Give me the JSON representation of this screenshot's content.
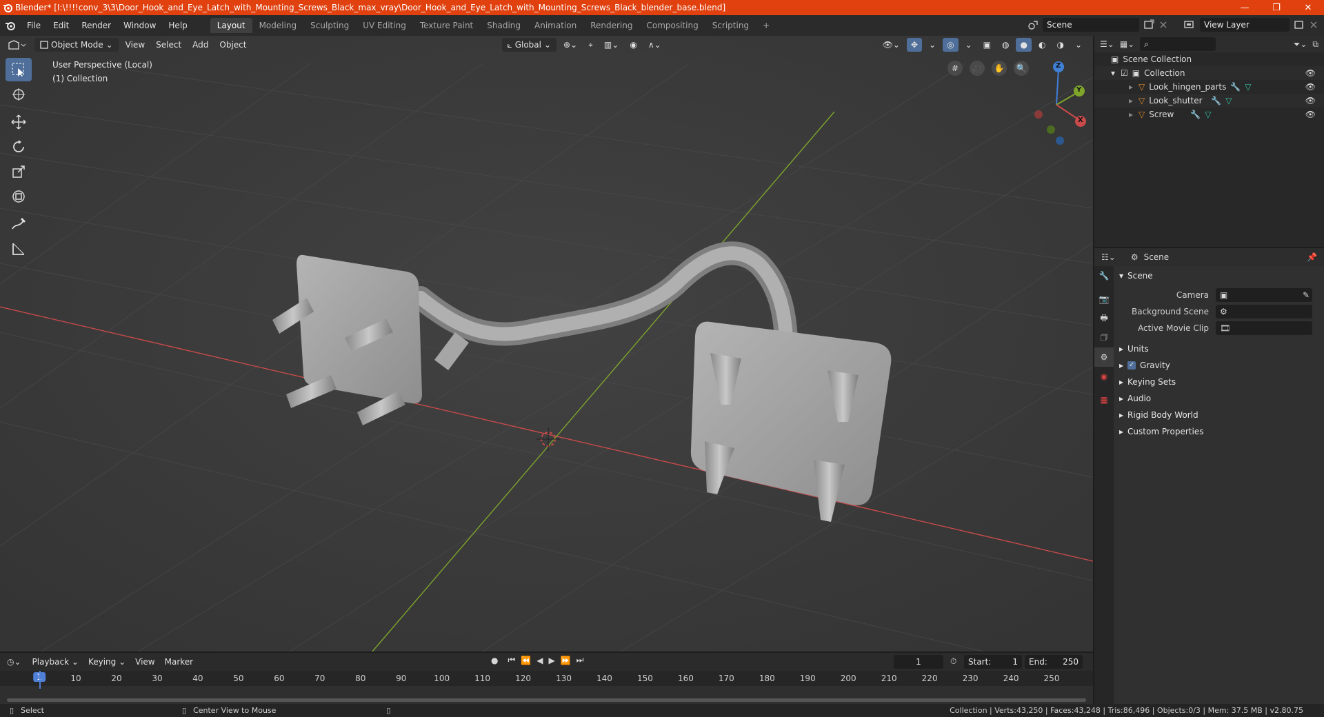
{
  "titlebar": {
    "title": "Blender* [I:\\!!!!conv_3\\3\\Door_Hook_and_Eye_Latch_with_Mounting_Screws_Black_max_vray\\Door_Hook_and_Eye_Latch_with_Mounting_Screws_Black_blender_base.blend]",
    "minimize": "—",
    "restore": "❐",
    "close": "✕"
  },
  "menu": {
    "items": [
      "File",
      "Edit",
      "Render",
      "Window",
      "Help"
    ],
    "workspaces": [
      "Layout",
      "Modeling",
      "Sculpting",
      "UV Editing",
      "Texture Paint",
      "Shading",
      "Animation",
      "Rendering",
      "Compositing",
      "Scripting"
    ],
    "active_workspace": "Layout",
    "add_tab": "+",
    "scene": "Scene",
    "view_layer": "View Layer"
  },
  "viewport": {
    "mode": "Object Mode",
    "menus": [
      "View",
      "Select",
      "Add",
      "Object"
    ],
    "orientation": "Global",
    "info_line1": "User Perspective (Local)",
    "info_line2": "(1) Collection",
    "gizmo_x": "X",
    "gizmo_y": "Y",
    "gizmo_z": "Z"
  },
  "outliner": {
    "search_placeholder": "",
    "root": "Scene Collection",
    "collection": "Collection",
    "objects": [
      "Look_hingen_parts",
      "Look_shutter",
      "Screw"
    ]
  },
  "properties": {
    "header_title": "Scene",
    "panel_title": "Scene",
    "camera_label": "Camera",
    "background_label": "Background Scene",
    "movie_clip_label": "Active Movie Clip",
    "sections": [
      "Units",
      "Gravity",
      "Keying Sets",
      "Audio",
      "Rigid Body World",
      "Custom Properties"
    ]
  },
  "timeline": {
    "menus": [
      "Playback",
      "Keying",
      "View",
      "Marker"
    ],
    "current_frame": "1",
    "start_label": "Start:",
    "start": "1",
    "end_label": "End:",
    "end": "250",
    "ticks": [
      "1",
      "10",
      "20",
      "30",
      "40",
      "50",
      "60",
      "70",
      "80",
      "90",
      "100",
      "110",
      "120",
      "130",
      "140",
      "150",
      "160",
      "170",
      "180",
      "190",
      "200",
      "210",
      "220",
      "230",
      "240",
      "250"
    ]
  },
  "status": {
    "left": "Select",
    "middle": "Center View to Mouse",
    "right": "Collection | Verts:43,250 | Faces:43,248 | Tris:86,496 | Objects:0/3 | Mem: 37.5 MB | v2.80.75"
  },
  "colors": {
    "titlebar": "#e0410f",
    "accent": "#4f6f9a",
    "x_axis": "#c94a4a",
    "y_axis": "#7fa52b",
    "z_axis": "#3f7fd6",
    "mesh": "#9a9a9a",
    "object_icon": "#e08a2c"
  }
}
